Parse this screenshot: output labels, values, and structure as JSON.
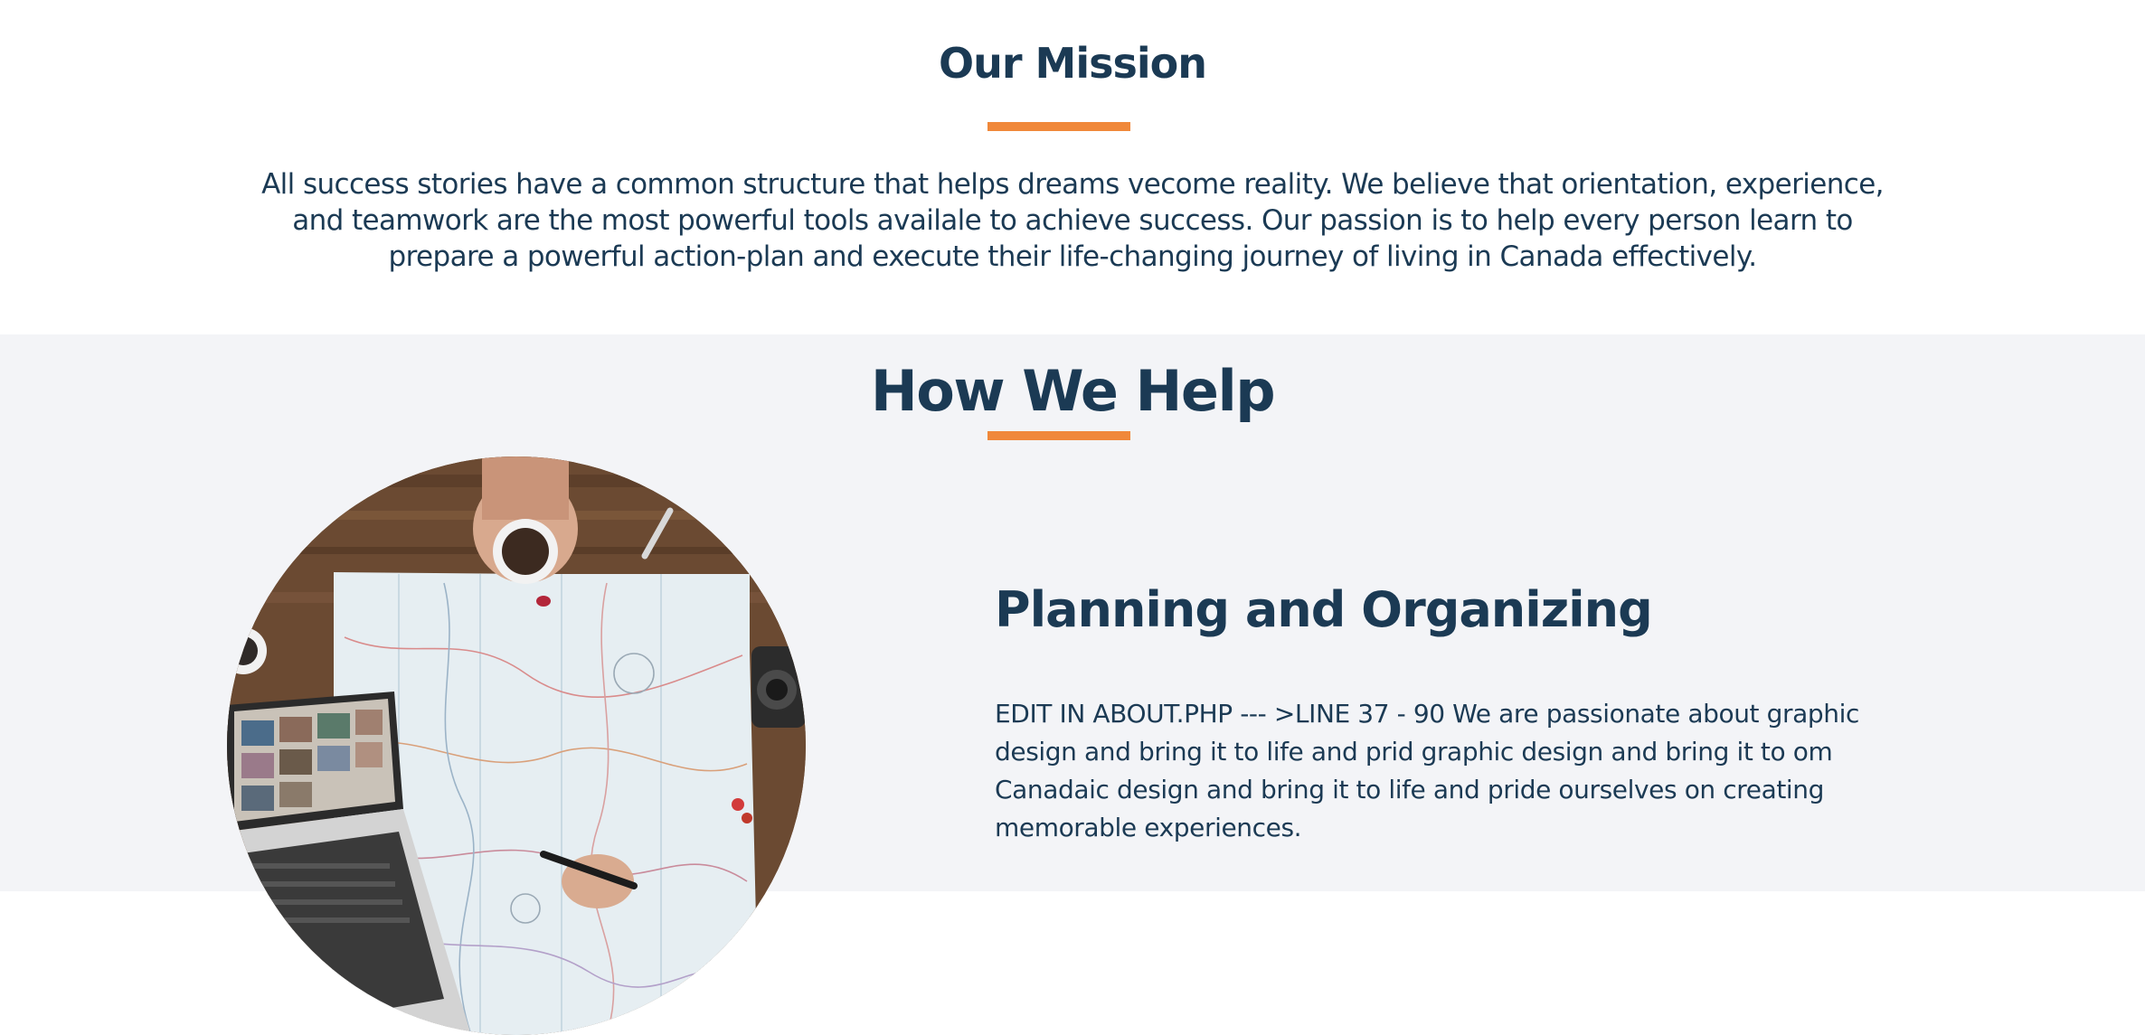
{
  "mission": {
    "title": "Our Mission",
    "text": "All success stories have a common structure that helps dreams vecome reality. We believe that orientation, experience, and teamwork are the most powerful tools availale to achieve success. Our passion is to help every person learn to prepare a powerful action-plan and execute their life-changing journey of living in Canada effectively."
  },
  "help": {
    "title": "How We Help",
    "feature": {
      "title": "Planning and Organizing",
      "text": "EDIT IN ABOUT.PHP --- >LINE 37 - 90 We are passionate about graphic design and bring it to life and prid graphic design and bring it to om Canadaic design and bring it to life and pride ourselves on creating memorable experiences."
    }
  },
  "colors": {
    "heading": "#1b3a54",
    "accent": "#f0883a",
    "section_bg": "#f3f4f7"
  }
}
